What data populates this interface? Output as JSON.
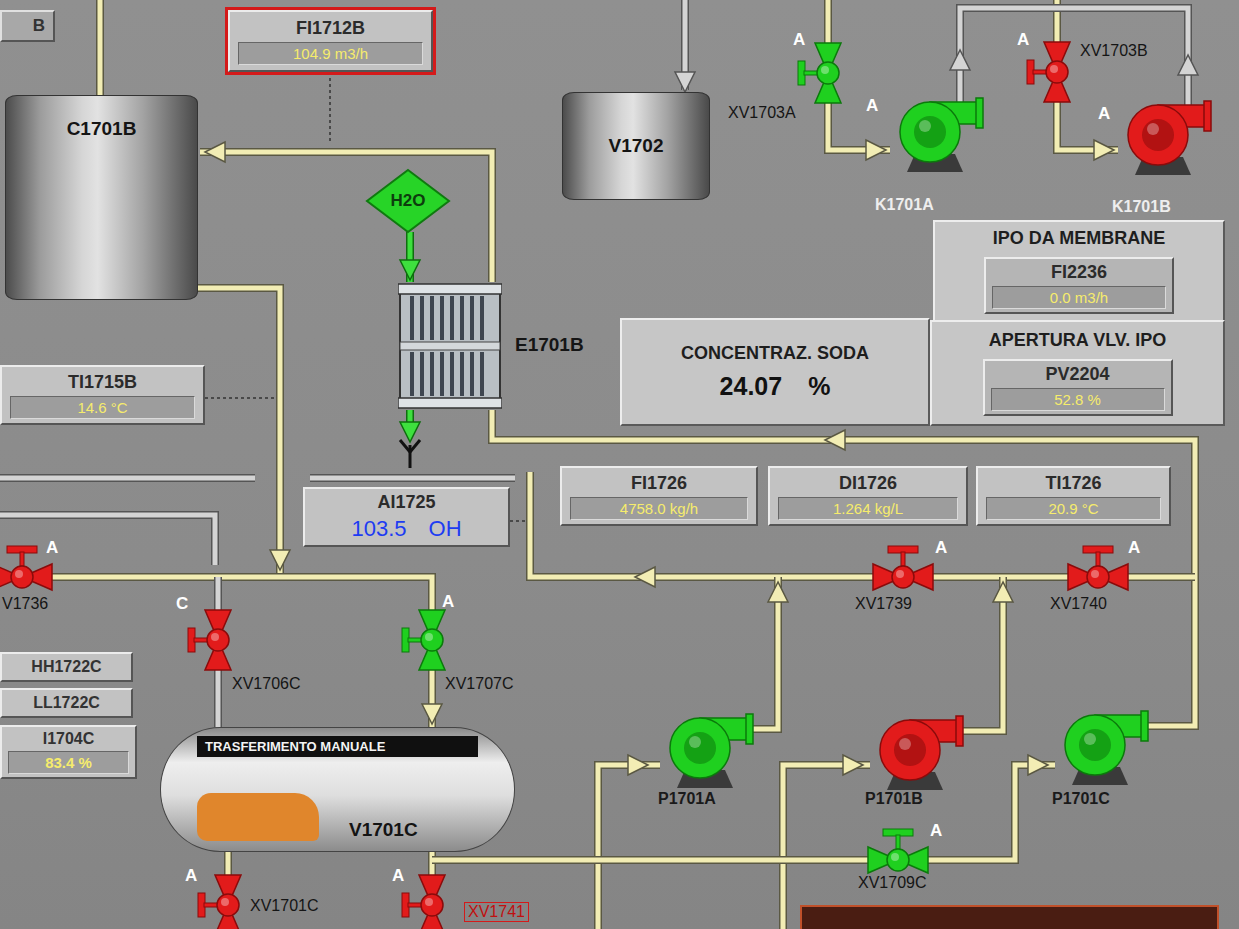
{
  "edge_box": {
    "label": "B"
  },
  "instruments": [
    {
      "tag": "FI1712B",
      "value": "104.9 m3/h",
      "alarm": true
    },
    {
      "tag": "TI1715B",
      "value": "14.6 °C",
      "alarm": false
    },
    {
      "tag": "FI1726",
      "value": "4758.0 kg/h",
      "alarm": false
    },
    {
      "tag": "DI1726",
      "value": "1.264 kg/L",
      "alarm": false
    },
    {
      "tag": "TI1726",
      "value": "20.9 °C",
      "alarm": false
    }
  ],
  "analyzer": {
    "tag": "AI1725",
    "value": "103.5",
    "unit": "OH"
  },
  "soda_panel": {
    "title": "CONCENTRAZ. SODA",
    "value": "24.07",
    "unit": "%"
  },
  "ipo_panels": [
    {
      "title": "IPO DA MEMBRANE",
      "tag": "FI2236",
      "value": "0.0 m3/h"
    },
    {
      "title": "APERTURA VLV. IPO",
      "tag": "PV2204",
      "value": "52.8 %"
    }
  ],
  "vessels": [
    {
      "tag": "C1701B"
    },
    {
      "tag": "V1702"
    }
  ],
  "exchanger": {
    "tag": "E1701B",
    "utility": "H2O"
  },
  "storage_tank": {
    "tag": "V1701C",
    "banner": "TRASFERIMENTO MANUALE",
    "level": 0.62
  },
  "level_alarms": [
    {
      "tag": "HH1722C"
    },
    {
      "tag": "LL1722C"
    }
  ],
  "level_indicator": {
    "tag": "I1704C",
    "value": "83.4 %"
  },
  "valves": [
    {
      "tag": "XV1703A",
      "mode": "A",
      "open": true,
      "alarm": false
    },
    {
      "tag": "XV1703B",
      "mode": "A",
      "open": false,
      "alarm": false
    },
    {
      "tag": "V1736",
      "mode": "A",
      "open": false,
      "alarm": false
    },
    {
      "tag": "XV1706C",
      "mode": "C",
      "open": false,
      "alarm": false
    },
    {
      "tag": "XV1707C",
      "mode": "A",
      "open": true,
      "alarm": false
    },
    {
      "tag": "XV1739",
      "mode": "A",
      "open": false,
      "alarm": false
    },
    {
      "tag": "XV1740",
      "mode": "A",
      "open": false,
      "alarm": false
    },
    {
      "tag": "XV1709C",
      "mode": "A",
      "open": true,
      "alarm": false
    },
    {
      "tag": "XV1701C",
      "mode": "A",
      "open": false,
      "alarm": false
    },
    {
      "tag": "XV1741",
      "mode": "A",
      "open": false,
      "alarm": true
    }
  ],
  "pumps": [
    {
      "tag": "K1701A",
      "mode": "A",
      "running": true
    },
    {
      "tag": "K1701B",
      "mode": "A",
      "running": false
    },
    {
      "tag": "P1701A",
      "running": true
    },
    {
      "tag": "P1701B",
      "running": false
    },
    {
      "tag": "P1701C",
      "running": true
    }
  ]
}
